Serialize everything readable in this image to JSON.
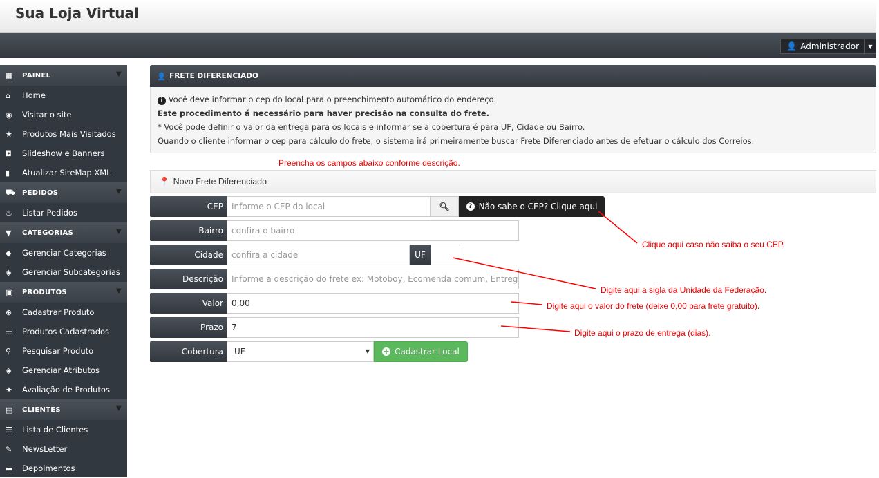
{
  "header": {
    "title": "Sua Loja Virtual",
    "user": "Administrador"
  },
  "sidebar": [
    {
      "section": "PAINEL",
      "icon": "grid-icon",
      "items": [
        {
          "label": "Home",
          "icon": "home-icon"
        },
        {
          "label": "Visitar o site",
          "icon": "globe-icon"
        },
        {
          "label": "Produtos Mais Visitados",
          "icon": "star-icon"
        },
        {
          "label": "Slideshow e Banners",
          "icon": "camera-icon"
        },
        {
          "label": "Atualizar SiteMap XML",
          "icon": "bookmark-icon"
        }
      ]
    },
    {
      "section": "PEDIDOS",
      "icon": "cart-icon",
      "items": [
        {
          "label": "Listar Pedidos",
          "icon": "fire-icon"
        }
      ]
    },
    {
      "section": "CATEGORIAS",
      "icon": "filter-icon",
      "items": [
        {
          "label": "Gerenciar Categorias",
          "icon": "tag-icon"
        },
        {
          "label": "Gerenciar Subcategorias",
          "icon": "tags-icon"
        }
      ]
    },
    {
      "section": "PRODUTOS",
      "icon": "gift-icon",
      "items": [
        {
          "label": "Cadastrar Produto",
          "icon": "plus-circle-icon"
        },
        {
          "label": "Produtos Cadastrados",
          "icon": "list-icon"
        },
        {
          "label": "Pesquisar Produto",
          "icon": "search-icon"
        },
        {
          "label": "Gerenciar Atributos",
          "icon": "tags-icon"
        },
        {
          "label": "Avaliação de Produtos",
          "icon": "star-icon"
        }
      ]
    },
    {
      "section": "CLIENTES",
      "icon": "briefcase-icon",
      "items": [
        {
          "label": "Lista de Clientes",
          "icon": "list-icon"
        },
        {
          "label": "NewsLetter",
          "icon": "pencil-icon"
        },
        {
          "label": "Depoimentos",
          "icon": "comment-icon"
        }
      ]
    }
  ],
  "panel": {
    "title": "FRETE DIFERENCIADO",
    "info": [
      "Você deve informar o cep do local para o preenchimento automático do endereço.",
      "Este procedimento á necessário para haver precisão na consulta do frete.",
      "* Você pode definir o valor da entrega para os locais e informar se a cobertura é para UF, Cidade ou Bairro.",
      "Quando o cliente informar o cep para cálculo do frete, o sistema irá primeiramente buscar Frete Diferenciado antes de efetuar o cálculo dos Correios."
    ]
  },
  "form": {
    "title": "Novo Frete Diferenciado",
    "cep": {
      "label": "CEP",
      "placeholder": "Informe o CEP do local"
    },
    "help_button": "Não sabe o CEP? Clique aqui",
    "bairro": {
      "label": "Bairro",
      "placeholder": "confira o bairro"
    },
    "cidade": {
      "label": "Cidade",
      "placeholder": "confira a cidade"
    },
    "uf": {
      "label": "UF",
      "value": ""
    },
    "descricao": {
      "label": "Descrição",
      "placeholder": "Informe a descrição do frete ex: Motoboy, Ecomenda comum, Entrega Expressa"
    },
    "valor": {
      "label": "Valor",
      "value": "0,00"
    },
    "prazo": {
      "label": "Prazo",
      "value": "7"
    },
    "cobertura": {
      "label": "Cobertura",
      "value": "UF"
    },
    "submit": "Cadastrar Local"
  },
  "annotations": {
    "top": "Preencha os campos abaixo conforme descrição.",
    "cep": "Clique aqui caso não saiba o seu CEP.",
    "uf": "Digite aqui a sigla da Unidade da Federação.",
    "valor": "Digite aqui o valor do frete (deixe 0,00 para frete gratuito).",
    "prazo": "Digite aqui o prazo de entrega (dias)."
  },
  "colors": {
    "annotation": "#ff0000",
    "success": "#5cb85c",
    "dark": "#33383f"
  }
}
